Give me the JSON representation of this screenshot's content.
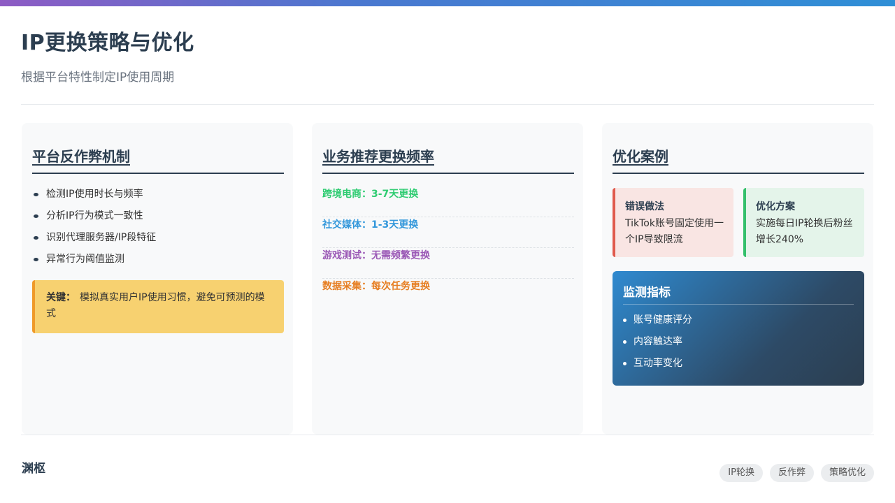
{
  "header": {
    "title": "IP更换策略与优化",
    "subtitle": "根据平台特性制定IP使用周期"
  },
  "columns": {
    "anti_fraud": {
      "title": "平台反作弊机制",
      "items": [
        "检测IP使用时长与频率",
        "分析IP行为模式一致性",
        "识别代理服务器/IP段特征",
        "异常行为阈值监测"
      ],
      "key_label": "关键：",
      "key_text": "模拟真实用户IP使用习惯，避免可预测的模式"
    },
    "frequency": {
      "title": "业务推荐更换频率",
      "items": [
        {
          "text": "跨境电商：3-7天更换",
          "color": "#2ecc71"
        },
        {
          "text": "社交媒体：1-3天更换",
          "color": "#3498db"
        },
        {
          "text": "游戏测试：无需频繁更换",
          "color": "#9b59b6"
        },
        {
          "text": "数据采集：每次任务更换",
          "color": "#e67e22"
        }
      ]
    },
    "cases": {
      "title": "优化案例",
      "bad_title": "错误做法",
      "bad_text": "TikTok账号固定使用一个IP导致限流",
      "good_title": "优化方案",
      "good_text": "实施每日IP轮换后粉丝增长240%",
      "monitor_title": "监测指标",
      "monitor_items": [
        "账号健康评分",
        "内容触达率",
        "互动率变化"
      ]
    }
  },
  "footer": {
    "brand": "渊枢",
    "tags": [
      "IP轮换",
      "反作弊",
      "策略优化"
    ]
  }
}
